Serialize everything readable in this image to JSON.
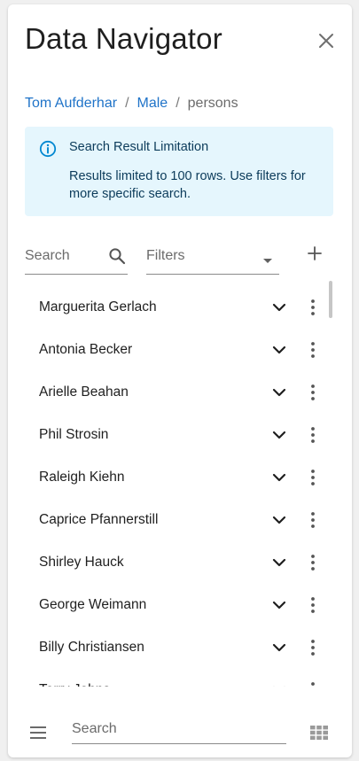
{
  "header": {
    "title": "Data Navigator",
    "close_icon": "close-icon"
  },
  "breadcrumb": {
    "items": [
      "Tom Aufderhar",
      "Male"
    ],
    "current": "persons",
    "separator": "/"
  },
  "alert": {
    "title": "Search Result Limitation",
    "body": "Results limited to 100 rows. Use filters for more specific search.",
    "icon": "info-icon",
    "background": "#e5f6fd"
  },
  "toolbar": {
    "search_placeholder": "Search",
    "filters_placeholder": "Filters",
    "add_icon": "plus-icon"
  },
  "list": {
    "rows": [
      "Marguerita Gerlach",
      "Antonia Becker",
      "Arielle Beahan",
      "Phil Strosin",
      "Raleigh Kiehn",
      "Caprice Pfannerstill",
      "Shirley Hauck",
      "George Weimann",
      "Billy Christiansen",
      "Terry Johns"
    ]
  },
  "footer": {
    "search_placeholder": "Search",
    "menu_icon": "hamburger-menu-icon",
    "grid_icon": "grid-view-icon"
  },
  "colors": {
    "link": "#1f73c8",
    "info": "#0288d1"
  }
}
